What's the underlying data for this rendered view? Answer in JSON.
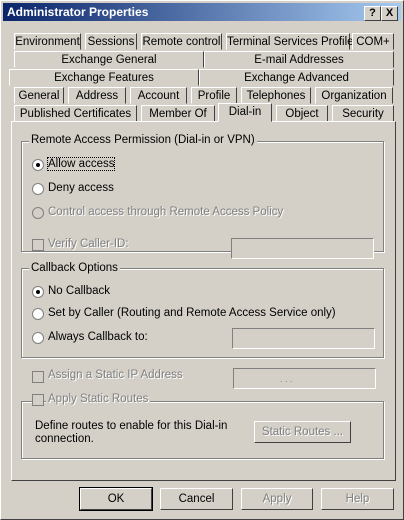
{
  "window": {
    "title": "Administrator Properties",
    "help_glyph": "?",
    "close_glyph": "X"
  },
  "tabs": {
    "row1": [
      "Environment",
      "Sessions",
      "Remote control",
      "Terminal Services Profile",
      "COM+"
    ],
    "row2": [
      "Exchange General",
      "E-mail Addresses"
    ],
    "row3": [
      "Exchange Features",
      "Exchange Advanced"
    ],
    "row4": [
      "General",
      "Address",
      "Account",
      "Profile",
      "Telephones",
      "Organization"
    ],
    "row5": [
      "Published Certificates",
      "Member Of",
      "Dial-in",
      "Object",
      "Security"
    ],
    "active": "Dial-in"
  },
  "remote_access": {
    "legend": "Remote Access Permission (Dial-in or VPN)",
    "allow": "Allow access",
    "deny": "Deny access",
    "policy": "Control access through Remote Access Policy",
    "selected": "allow"
  },
  "verify_caller": {
    "label": "Verify Caller-ID:",
    "value": ""
  },
  "callback": {
    "legend": "Callback Options",
    "no_callback": "No Callback",
    "set_by_caller": "Set by Caller (Routing and Remote Access Service only)",
    "always": "Always Callback to:",
    "selected": "no_callback",
    "always_value": ""
  },
  "static_ip": {
    "label": "Assign a Static IP Address",
    "value": ". . ."
  },
  "static_routes": {
    "label": "Apply Static Routes",
    "description": "Define routes to enable for this Dial-in connection.",
    "button": "Static Routes ..."
  },
  "buttons": {
    "ok": "OK",
    "cancel": "Cancel",
    "apply": "Apply",
    "help": "Help"
  },
  "colors": {
    "title_bar": "#0a246a",
    "face": "#d4d0c8",
    "disabled_text": "#808080"
  }
}
